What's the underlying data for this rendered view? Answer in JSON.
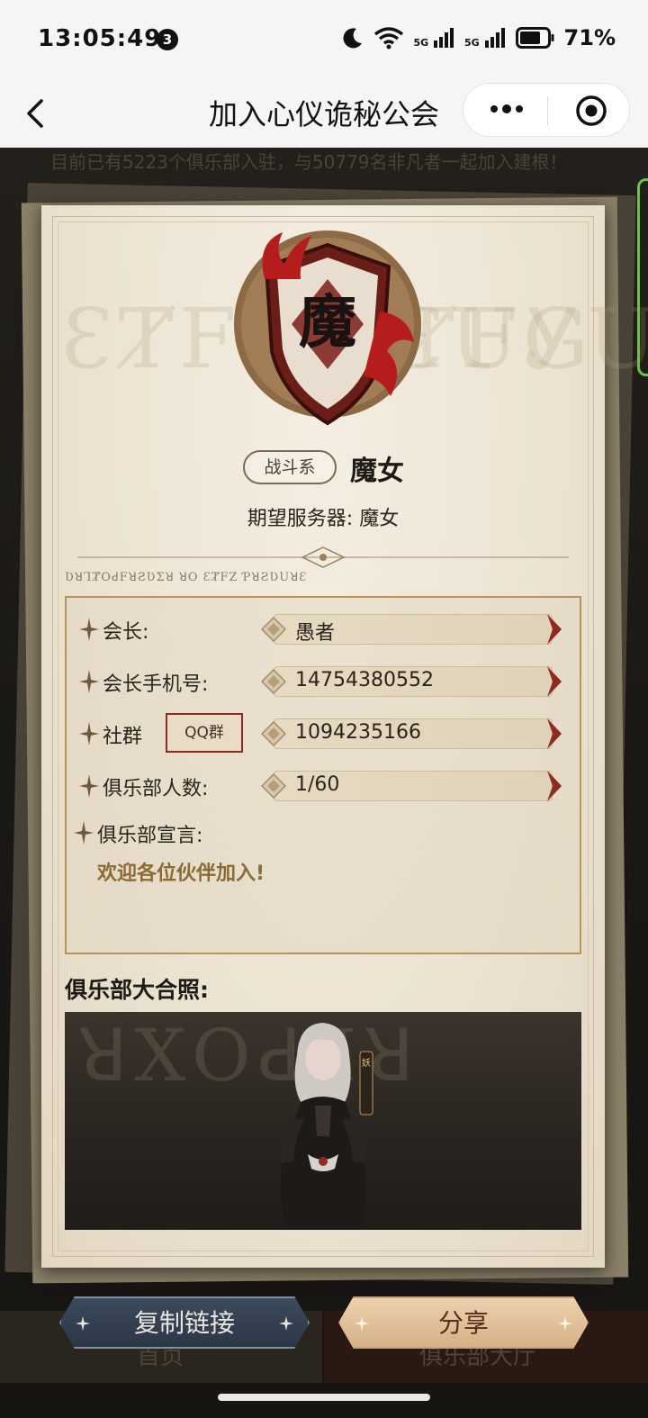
{
  "status_bar": {
    "time": "13:05:49",
    "notification_count": "3",
    "network_1": "5G",
    "network_2": "5G",
    "battery": "71%"
  },
  "nav": {
    "title": "加入心仪诡秘公会"
  },
  "background": {
    "notice": "目前已有5223个俱乐部入驻，与50779名非凡者一起加入建根！",
    "tab_home": "首页",
    "tab_club_hall": "俱乐部大厅"
  },
  "card": {
    "emblem_char": "魔",
    "category_tag": "战斗系",
    "class_name": "魔女",
    "server_label": "期望服务器:",
    "server_value": "魔女",
    "watermark_left": "ƐȾFZ ƵȾFG",
    "watermark_right": "ƐUᎩUȾƱ",
    "runes": "ƲꓤꞀȾOꓒFꓤƧƲƩꓤ ꓤO ƐȾFZ ƤꓤƧƲUꓤƐ"
  },
  "info": {
    "president_label": "会长:",
    "president_value": "愚者",
    "phone_label": "会长手机号:",
    "phone_value": "14754380552",
    "community_label": "社群",
    "community_tag": "QQ群",
    "community_value": "1094235166",
    "members_label": "俱乐部人数:",
    "members_value": "1/60",
    "declaration_label": "俱乐部宣言:",
    "declaration_value": "欢迎各位伙伴加入!"
  },
  "photo": {
    "label": "俱乐部大合照:",
    "watermark": "ꓤXOꓒꞀꓤ",
    "badge": "妖"
  },
  "actions": {
    "copy_link": "复制链接",
    "share": "分享"
  },
  "colors": {
    "accent_red": "#8f2a22",
    "gold": "#b9925e",
    "paper": "#ece3d2"
  }
}
